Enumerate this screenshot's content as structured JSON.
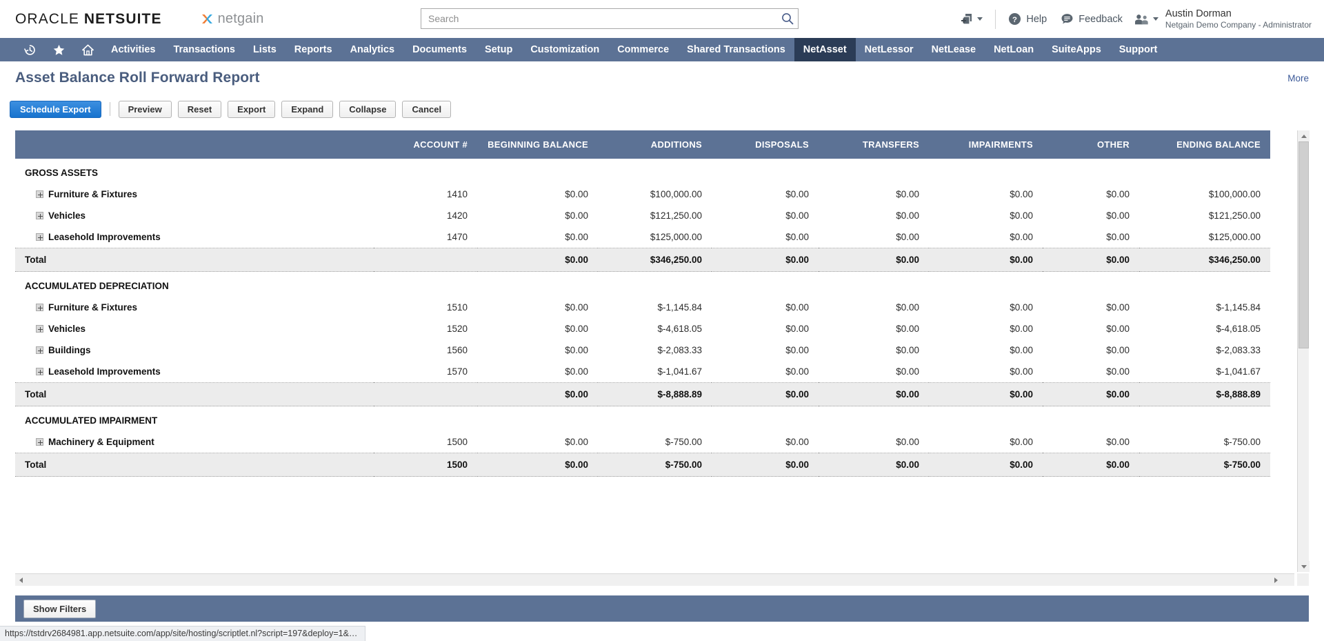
{
  "header": {
    "brand_oracle_light": "ORACLE ",
    "brand_oracle_bold": "NETSUITE",
    "brand_partner": "netgain",
    "search_placeholder": "Search",
    "search_value": "",
    "help_label": "Help",
    "feedback_label": "Feedback",
    "user_name": "Austin Dorman",
    "user_role": "Netgain Demo Company - Administrator",
    "icons": {
      "search": "search-icon",
      "create_new": "create-new-icon",
      "help": "help-question-icon",
      "feedback": "feedback-speech-icon",
      "user": "user-group-icon"
    }
  },
  "nav": {
    "icon_items": [
      {
        "name": "recent-records-icon",
        "glyph": "recent"
      },
      {
        "name": "favorites-star-icon",
        "glyph": "star"
      },
      {
        "name": "home-icon",
        "glyph": "home"
      }
    ],
    "items": [
      {
        "label": "Activities",
        "active": false
      },
      {
        "label": "Transactions",
        "active": false
      },
      {
        "label": "Lists",
        "active": false
      },
      {
        "label": "Reports",
        "active": false
      },
      {
        "label": "Analytics",
        "active": false
      },
      {
        "label": "Documents",
        "active": false
      },
      {
        "label": "Setup",
        "active": false
      },
      {
        "label": "Customization",
        "active": false
      },
      {
        "label": "Commerce",
        "active": false
      },
      {
        "label": "Shared Transactions",
        "active": false
      },
      {
        "label": "NetAsset",
        "active": true
      },
      {
        "label": "NetLessor",
        "active": false
      },
      {
        "label": "NetLease",
        "active": false
      },
      {
        "label": "NetLoan",
        "active": false
      },
      {
        "label": "SuiteApps",
        "active": false
      },
      {
        "label": "Support",
        "active": false
      }
    ]
  },
  "page": {
    "title": "Asset Balance Roll Forward Report",
    "more_label": "More"
  },
  "toolbar": {
    "schedule_export_label": "Schedule Export",
    "preview_label": "Preview",
    "reset_label": "Reset",
    "export_label": "Export",
    "expand_label": "Expand",
    "collapse_label": "Collapse",
    "cancel_label": "Cancel"
  },
  "report": {
    "columns": [
      "",
      "ACCOUNT #",
      "BEGINNING BALANCE",
      "ADDITIONS",
      "DISPOSALS",
      "TRANSFERS",
      "IMPAIRMENTS",
      "OTHER",
      "ENDING BALANCE"
    ],
    "sections": [
      {
        "title": "GROSS ASSETS",
        "rows": [
          {
            "label": "Furniture & Fixtures",
            "account": "1410",
            "beginning": "$0.00",
            "additions": "$100,000.00",
            "disposals": "$0.00",
            "transfers": "$0.00",
            "impairments": "$0.00",
            "other": "$0.00",
            "ending": "$100,000.00"
          },
          {
            "label": "Vehicles",
            "account": "1420",
            "beginning": "$0.00",
            "additions": "$121,250.00",
            "disposals": "$0.00",
            "transfers": "$0.00",
            "impairments": "$0.00",
            "other": "$0.00",
            "ending": "$121,250.00"
          },
          {
            "label": "Leasehold Improvements",
            "account": "1470",
            "beginning": "$0.00",
            "additions": "$125,000.00",
            "disposals": "$0.00",
            "transfers": "$0.00",
            "impairments": "$0.00",
            "other": "$0.00",
            "ending": "$125,000.00"
          }
        ],
        "total": {
          "label": "Total",
          "account": "",
          "beginning": "$0.00",
          "additions": "$346,250.00",
          "disposals": "$0.00",
          "transfers": "$0.00",
          "impairments": "$0.00",
          "other": "$0.00",
          "ending": "$346,250.00"
        }
      },
      {
        "title": "ACCUMULATED DEPRECIATION",
        "rows": [
          {
            "label": "Furniture & Fixtures",
            "account": "1510",
            "beginning": "$0.00",
            "additions": "$-1,145.84",
            "disposals": "$0.00",
            "transfers": "$0.00",
            "impairments": "$0.00",
            "other": "$0.00",
            "ending": "$-1,145.84"
          },
          {
            "label": "Vehicles",
            "account": "1520",
            "beginning": "$0.00",
            "additions": "$-4,618.05",
            "disposals": "$0.00",
            "transfers": "$0.00",
            "impairments": "$0.00",
            "other": "$0.00",
            "ending": "$-4,618.05"
          },
          {
            "label": "Buildings",
            "account": "1560",
            "beginning": "$0.00",
            "additions": "$-2,083.33",
            "disposals": "$0.00",
            "transfers": "$0.00",
            "impairments": "$0.00",
            "other": "$0.00",
            "ending": "$-2,083.33"
          },
          {
            "label": "Leasehold Improvements",
            "account": "1570",
            "beginning": "$0.00",
            "additions": "$-1,041.67",
            "disposals": "$0.00",
            "transfers": "$0.00",
            "impairments": "$0.00",
            "other": "$0.00",
            "ending": "$-1,041.67"
          }
        ],
        "total": {
          "label": "Total",
          "account": "",
          "beginning": "$0.00",
          "additions": "$-8,888.89",
          "disposals": "$0.00",
          "transfers": "$0.00",
          "impairments": "$0.00",
          "other": "$0.00",
          "ending": "$-8,888.89"
        }
      },
      {
        "title": "ACCUMULATED IMPAIRMENT",
        "rows": [
          {
            "label": "Machinery & Equipment",
            "account": "1500",
            "beginning": "$0.00",
            "additions": "$-750.00",
            "disposals": "$0.00",
            "transfers": "$0.00",
            "impairments": "$0.00",
            "other": "$0.00",
            "ending": "$-750.00"
          }
        ],
        "total": {
          "label": "Total",
          "account": "1500",
          "beginning": "$0.00",
          "additions": "$-750.00",
          "disposals": "$0.00",
          "transfers": "$0.00",
          "impairments": "$0.00",
          "other": "$0.00",
          "ending": "$-750.00"
        }
      }
    ]
  },
  "footer": {
    "show_filters_label": "Show Filters",
    "status_url": "https://tstdrv2684981.app.netsuite.com/app/site/hosting/scriptlet.nl?script=197&deploy=1&compid=TSTDRV26849..."
  },
  "colors": {
    "nav_bg": "#5c7295",
    "nav_active": "#2b3c56",
    "title": "#4a5d7e",
    "primary_button": "#1773ce",
    "total_row": "#ececec"
  }
}
